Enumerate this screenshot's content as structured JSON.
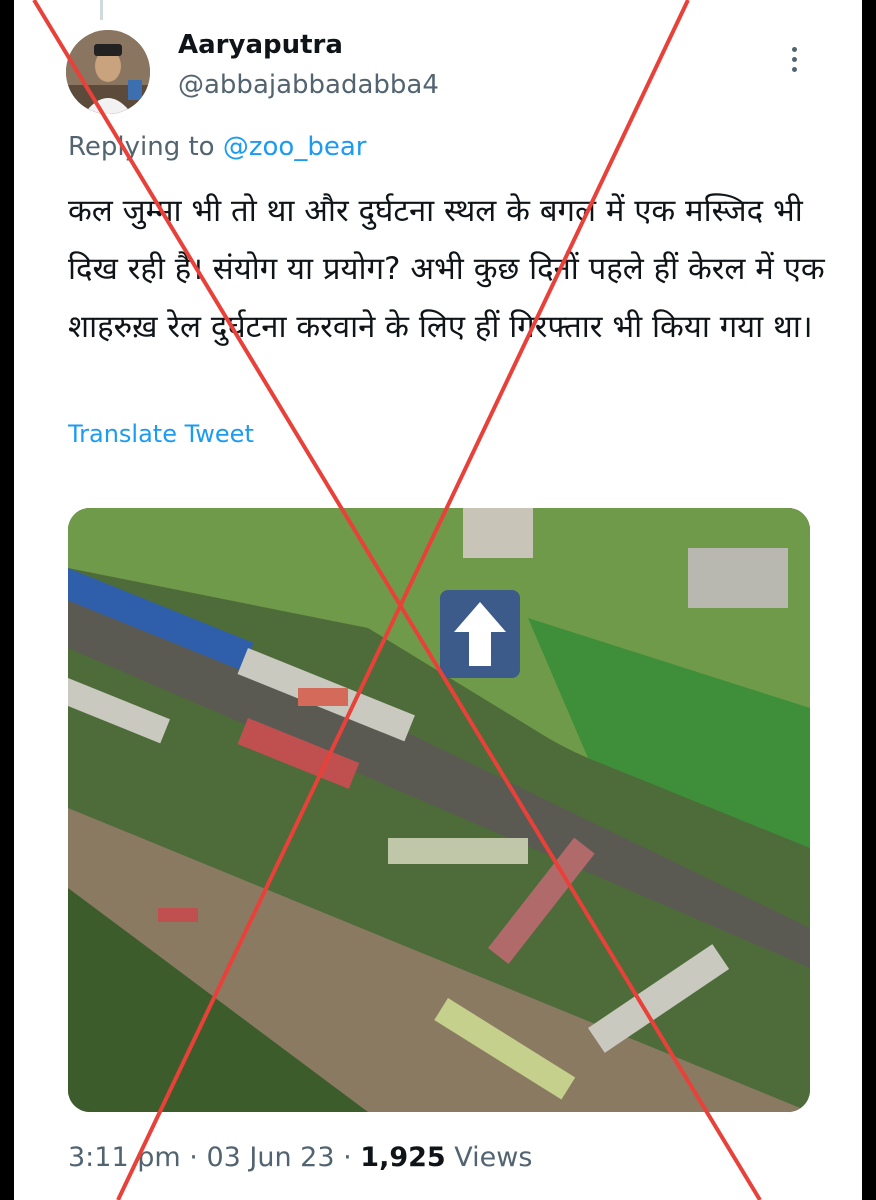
{
  "tweet": {
    "author_name": "Aaryaputra",
    "author_handle": "@abbajabbadabba4",
    "reply_prefix": "Replying to",
    "reply_to": "@zoo_bear",
    "text": "कल जुम्मा भी तो था और दुर्घटना स्थल के बगल में एक मस्जिद भी दिख रही है। संयोग या प्रयोग? अभी कुछ दिनों पहले हीं केरल में एक शाहरुख़ रेल दुर्घटना करवाने के लिए हीं गिरफ्तार भी किया गया था।",
    "translate_label": "Translate Tweet",
    "time": "3:11 pm",
    "date": "03 Jun 23",
    "separator": "·",
    "views_count": "1,925",
    "views_label": "Views"
  },
  "colors": {
    "link": "#1d9bf0",
    "secondary_text": "#536471",
    "primary_text": "#0f1419",
    "cross_mark": "#e8413a"
  },
  "icons": [
    "more-options-icon",
    "up-arrow-icon"
  ]
}
